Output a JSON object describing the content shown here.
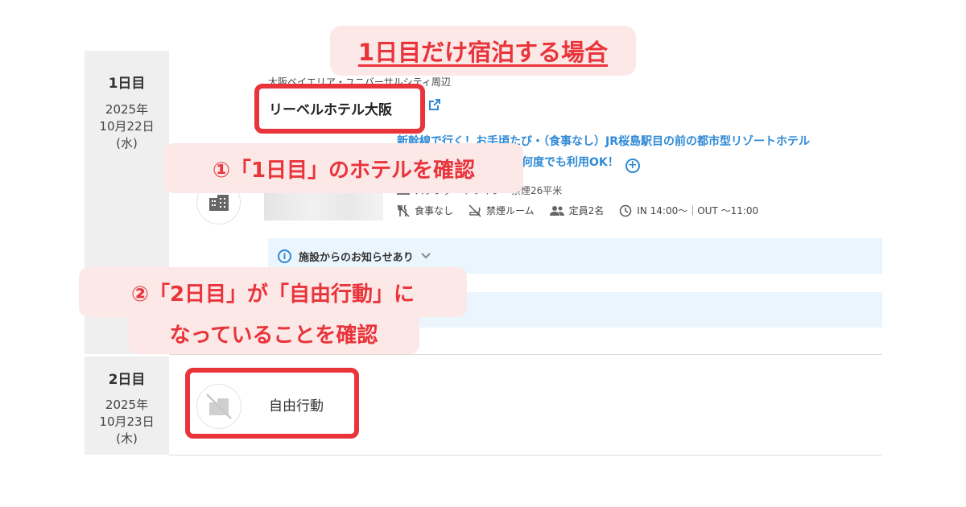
{
  "banner": {
    "title": "1日目だけ宿泊する場合"
  },
  "days": [
    {
      "label": "1日目",
      "year": "2025年",
      "monthday": "10月22日",
      "weekday": "(水)"
    },
    {
      "label": "2日目",
      "year": "2025年",
      "monthday": "10月23日",
      "weekday": "(木)"
    }
  ],
  "hotel": {
    "area": "大阪ベイエリア・ユニバーサルシティ周辺",
    "name": "リーベルホテル大阪",
    "plan_line1": "新幹線で行く！お手頃たび・（食事なし）JR桜島駅目の前の都市型リゾートホテル",
    "plan_line2": "何度でも利用OK！",
    "room": "スタンダードツイン　禁煙26平米",
    "amenities": [
      {
        "icon": "no-meal-icon",
        "label": "食事なし"
      },
      {
        "icon": "no-smoking-icon",
        "label": "禁煙ルーム"
      },
      {
        "icon": "people-icon",
        "label": "定員2名"
      },
      {
        "icon": "clock-icon",
        "label": "IN 14:00〜｜OUT 〜11:00"
      }
    ],
    "notice": "施設からのお知らせあり"
  },
  "day2": {
    "status": "自由行動"
  },
  "callouts": {
    "step1": "①「1日目」のホテルを確認",
    "step2_line1": "②「2日目」が「自由行動」に",
    "step2_line2": "なっていることを確認"
  },
  "colors": {
    "accent": "#e8343a",
    "accent_bg": "#fde8e8",
    "link": "#2f8ad6",
    "notice_bg": "#eaf5fd"
  }
}
